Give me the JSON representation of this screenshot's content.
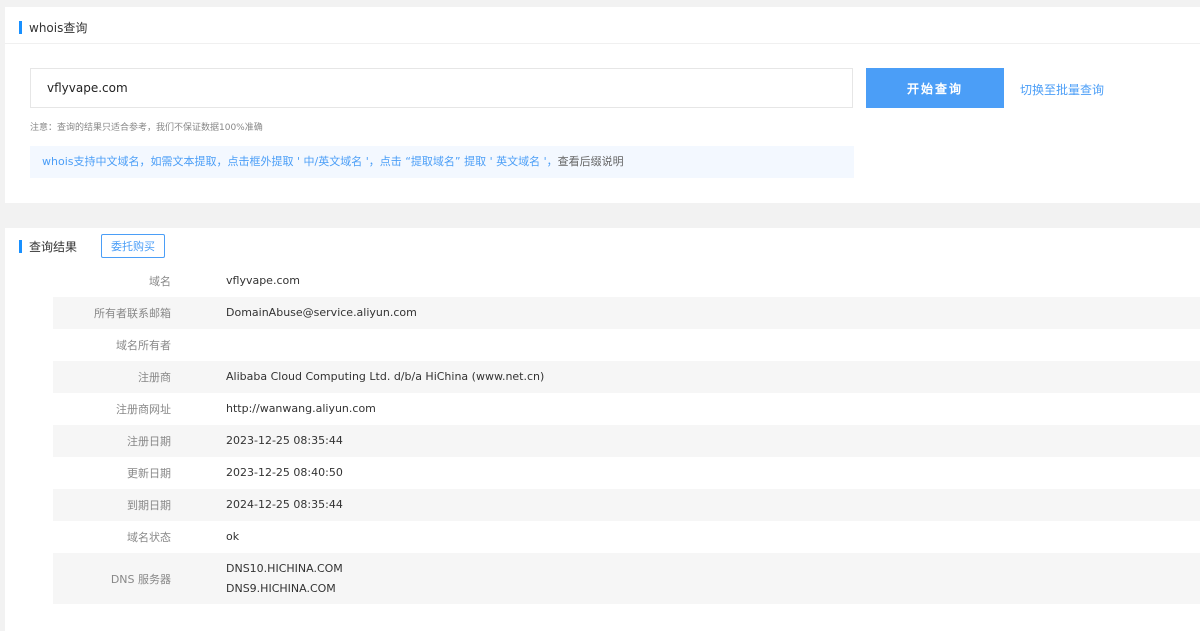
{
  "whois": {
    "section_title": "whois查询",
    "search_value": "vflyvape.com",
    "start_button": "开始查询",
    "switch_link": "切换至批量查询",
    "note": "注意：查询的结果只适合参考，我们不保证数据100%准确",
    "tip": {
      "main": "whois支持中文域名，如需文本提取，点击框外提取 ' 中/英文域名 '，点击 “提取域名” 提取 ' 英文域名 '，",
      "link": "查看后缀说明"
    }
  },
  "results": {
    "section_title": "查询结果",
    "consign_button": "委托购买",
    "rows": [
      {
        "label": "域名",
        "value": "vflyvape.com"
      },
      {
        "label": "所有者联系邮箱",
        "value": "DomainAbuse@service.aliyun.com"
      },
      {
        "label": "域名所有者",
        "value": ""
      },
      {
        "label": "注册商",
        "value": "Alibaba Cloud Computing Ltd. d/b/a HiChina (www.net.cn)"
      },
      {
        "label": "注册商网址",
        "value": "http://wanwang.aliyun.com"
      },
      {
        "label": "注册日期",
        "value": "2023-12-25 08:35:44"
      },
      {
        "label": "更新日期",
        "value": "2023-12-25 08:40:50"
      },
      {
        "label": "到期日期",
        "value": "2024-12-25 08:35:44"
      },
      {
        "label": "域名状态",
        "value": "ok"
      }
    ],
    "dns": {
      "label": "DNS 服务器",
      "servers": [
        "DNS10.HICHINA.COM",
        "DNS9.HICHINA.COM"
      ]
    }
  },
  "colors": {
    "accent": "#4b9ef7",
    "tip_background": "#f3f8ff",
    "row_alt": "#f6f6f6"
  }
}
